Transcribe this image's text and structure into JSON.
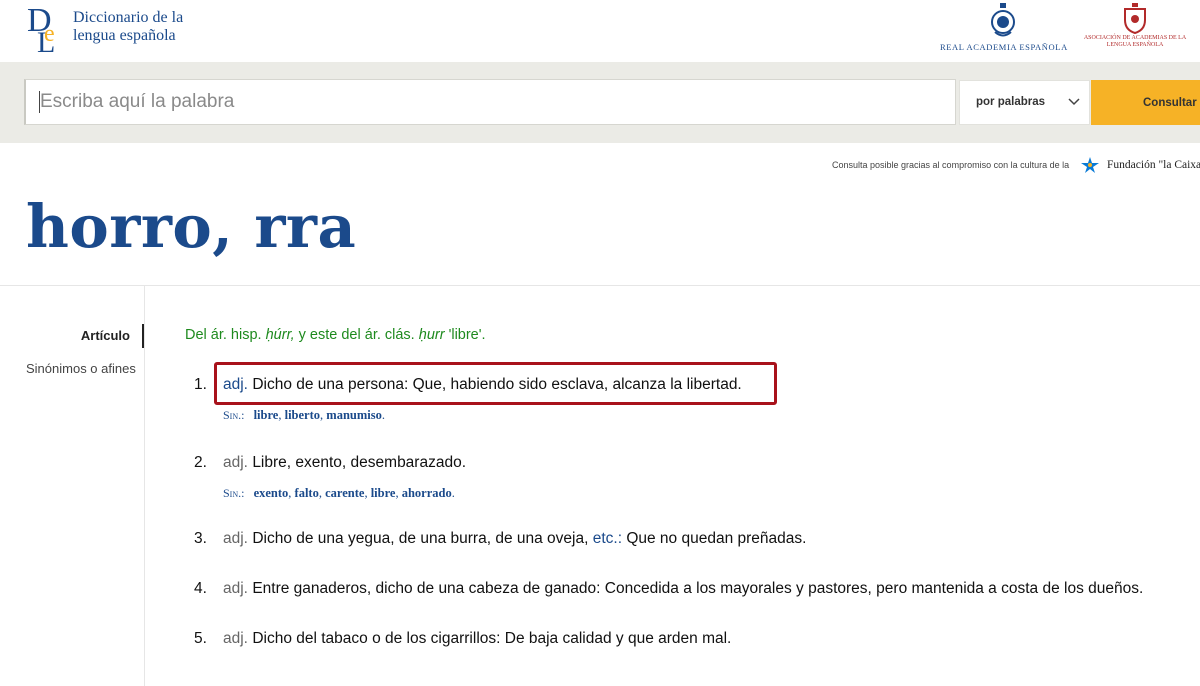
{
  "brand": {
    "logo_letters": "DLE",
    "title_line1": "Diccionario de la",
    "title_line2": "lengua española"
  },
  "partners": {
    "rae": "Real Academia Española",
    "asale_line1": "Asociación de Academias de la",
    "asale_line2": "lengua española"
  },
  "search": {
    "placeholder": "Escriba aquí la palabra",
    "mode": "por palabras",
    "button": "Consultar"
  },
  "sponsor": {
    "text": "Consulta posible gracias al compromiso con la cultura de la",
    "name": "Fundación \"la Caixa\""
  },
  "entry": {
    "headword": "horro, rra",
    "etymology": {
      "prefix": "Del ár. hisp.",
      "term1": "ḥúrr,",
      "middle": "y este del ár. clás.",
      "term2": "ḥurr",
      "gloss": "'libre'."
    },
    "definitions": [
      {
        "num": "1.",
        "abbr": "adj.",
        "text": "Dicho de una persona: Que, habiendo sido esclava, alcanza la libertad."
      },
      {
        "num": "2.",
        "abbr": "adj.",
        "text": "Libre, exento, desembarazado."
      },
      {
        "num": "3.",
        "abbr": "adj.",
        "text": "Dicho de una yegua, de una burra, de una oveja,",
        "etc": "etc.:",
        "text2": "Que no quedan preñadas."
      },
      {
        "num": "4.",
        "abbr": "adj.",
        "text": "Entre ganaderos, dicho de una cabeza de ganado: Concedida a los mayorales y pastores, pero mantenida a costa de los dueños."
      },
      {
        "num": "5.",
        "abbr": "adj.",
        "text": "Dicho del tabaco o de los cigarrillos: De baja calidad y que arden mal."
      }
    ],
    "synonyms": {
      "label": "Sin.:",
      "def1": [
        "libre",
        "liberto",
        "manumiso"
      ],
      "def2": [
        "exento",
        "falto",
        "carente",
        "libre",
        "ahorrado"
      ]
    }
  },
  "sidebar": {
    "items": [
      {
        "label": "Artículo",
        "active": true
      },
      {
        "label": "Sinónimos o afines",
        "active": false
      }
    ]
  },
  "colors": {
    "brand_blue": "#1b4a8b",
    "button_yellow": "#f6b226",
    "etymology_green": "#1e8a1e",
    "highlight_red": "#a8121b"
  }
}
